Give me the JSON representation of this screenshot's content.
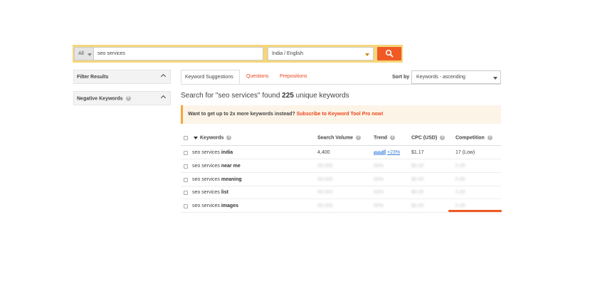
{
  "search": {
    "scope_label": "All",
    "keyword_value": "seo services",
    "location_value": "India / English"
  },
  "filters": {
    "filter_results_label": "Filter Results",
    "negative_keywords_label": "Negative Keywords"
  },
  "tabs": [
    {
      "label": "Keyword Suggestions",
      "active": true
    },
    {
      "label": "Questions",
      "active": false
    },
    {
      "label": "Prepositions",
      "active": false
    }
  ],
  "sort": {
    "label": "Sort by",
    "value": "Keywords - ascending"
  },
  "summary": {
    "prefix": "Search for \"seo services\" found",
    "count": "225",
    "suffix": "unique keywords"
  },
  "promo": {
    "text": "Want to get up to 2x more keywords instead?",
    "link": "Subscribe to Keyword Tool Pro now!"
  },
  "table": {
    "headers": {
      "keywords": "Keywords",
      "search_volume": "Search Volume",
      "trend": "Trend",
      "cpc": "CPC (USD)",
      "competition": "Competition"
    },
    "rows": [
      {
        "base": "seo services",
        "suffix": "india",
        "volume": "4,400",
        "trend": "+23%",
        "cpc": "$1.17",
        "competition": "17 (Low)",
        "blurred": false
      },
      {
        "base": "seo services",
        "suffix": "near me",
        "volume": "00,000",
        "trend": "00%",
        "cpc": "$0.00",
        "competition": "0.00",
        "blurred": true
      },
      {
        "base": "seo services",
        "suffix": "meaning",
        "volume": "00,000",
        "trend": "00%",
        "cpc": "$0.00",
        "competition": "0.00",
        "blurred": true
      },
      {
        "base": "seo services",
        "suffix": "list",
        "volume": "00,000",
        "trend": "00%",
        "cpc": "$0.00",
        "competition": "0.00",
        "blurred": true
      },
      {
        "base": "seo services",
        "suffix": "images",
        "volume": "00,000",
        "trend": "00%",
        "cpc": "$0.00",
        "competition": "0.00",
        "blurred": true
      }
    ]
  },
  "colors": {
    "accent": "#ef5a24",
    "search_bar_bg": "#f5d67a",
    "link": "#e8461a",
    "trend": "#3b7dd8"
  },
  "icons": {
    "search": "search-icon",
    "help": "help-icon",
    "chevron": "chevron-up-icon",
    "dropdown": "caret-down-icon"
  }
}
